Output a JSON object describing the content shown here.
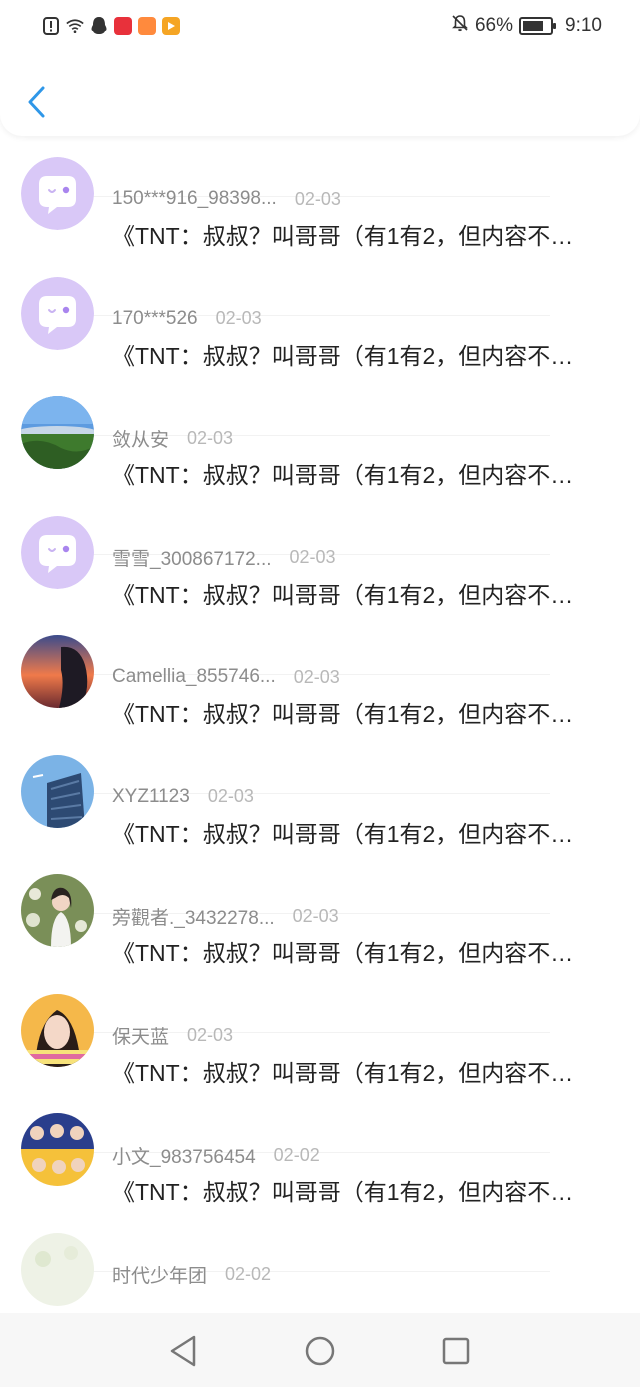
{
  "status_bar": {
    "battery": "66%",
    "battery_level": 0.66,
    "time": "9:10",
    "icons": [
      "alert-icon",
      "wifi-icon",
      "qq-icon",
      "app-icon",
      "app-icon",
      "video-app-icon"
    ],
    "app_colors": [
      "#e8313b",
      "#ff8a3d",
      "#f5a524"
    ]
  },
  "comments": [
    {
      "name": "",
      "date": "",
      "text": "《TNT：叔叔？叫哥哥（有1有2，但内容不…",
      "avatar": "default"
    },
    {
      "name": "150***916_98398...",
      "date": "02-03",
      "text": "《TNT：叔叔？叫哥哥（有1有2，但内容不…",
      "avatar": "default"
    },
    {
      "name": "170***526",
      "date": "02-03",
      "text": "《TNT：叔叔？叫哥哥（有1有2，但内容不…",
      "avatar": "default"
    },
    {
      "name": "敛从安",
      "date": "02-03",
      "text": "《TNT：叔叔？叫哥哥（有1有2，但内容不…",
      "avatar": "landscape"
    },
    {
      "name": "雪雪_300867172...",
      "date": "02-03",
      "text": "《TNT：叔叔？叫哥哥（有1有2，但内容不…",
      "avatar": "default"
    },
    {
      "name": "Camellia_855746...",
      "date": "02-03",
      "text": "《TNT：叔叔？叫哥哥（有1有2，但内容不…",
      "avatar": "sunset"
    },
    {
      "name": "XYZ1123",
      "date": "02-03",
      "text": "《TNT：叔叔？叫哥哥（有1有2，但内容不…",
      "avatar": "building"
    },
    {
      "name": "旁觀者._3432278...",
      "date": "02-03",
      "text": "《TNT：叔叔？叫哥哥（有1有2，但内容不…",
      "avatar": "girl-flowers"
    },
    {
      "name": "保天蓝",
      "date": "02-03",
      "text": "《TNT：叔叔？叫哥哥（有1有2，但内容不…",
      "avatar": "girl-portrait"
    },
    {
      "name": "小文_983756454",
      "date": "02-02",
      "text": "《TNT：叔叔？叫哥哥（有1有2，但内容不…",
      "avatar": "group"
    },
    {
      "name": "时代少年团",
      "date": "02-02",
      "text": "",
      "avatar": "flowers"
    }
  ],
  "colors": {
    "default_avatar": "#d9c8f7",
    "back_arrow": "#2f97e8"
  }
}
